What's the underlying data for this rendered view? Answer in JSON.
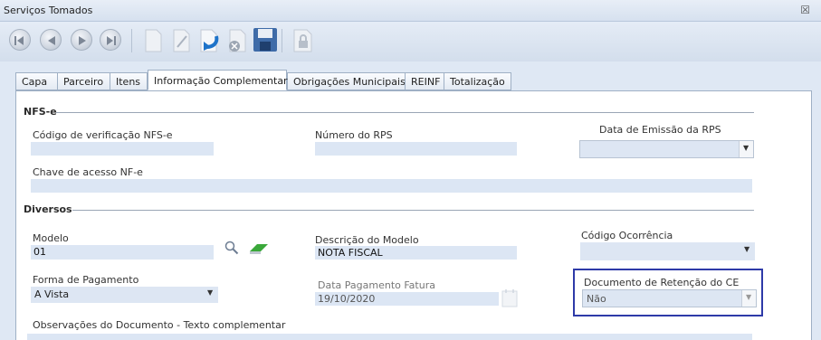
{
  "window": {
    "title": "Serviços Tomados",
    "close_glyph": "☒"
  },
  "tabs": [
    {
      "label": "Capa"
    },
    {
      "label": "Parceiro"
    },
    {
      "label": "Itens"
    },
    {
      "label": "Informação Complementar"
    },
    {
      "label": "Obrigações Municipais"
    },
    {
      "label": "REINF"
    },
    {
      "label": "Totalização"
    }
  ],
  "active_tab": 3,
  "nfse": {
    "section_title": "NFS-e",
    "codigo_label": "Código de verificação NFS-e",
    "codigo_value": "",
    "numero_rps_label": "Número do RPS",
    "numero_rps_value": "",
    "data_emissao_label": "Data de Emissão da RPS",
    "data_emissao_value": "",
    "chave_label": "Chave de acesso NF-e",
    "chave_value": ""
  },
  "diversos": {
    "section_title": "Diversos",
    "modelo_label": "Modelo",
    "modelo_value": "01",
    "descricao_label": "Descrição do Modelo",
    "descricao_value": "NOTA FISCAL",
    "ocorrencia_label": "Código Ocorrência",
    "ocorrencia_value": "",
    "forma_label": "Forma de Pagamento",
    "forma_value": "A Vista",
    "data_pag_label": "Data Pagamento Fatura",
    "data_pag_value": "19/10/2020",
    "doc_ret_label": "Documento de Retenção do CE",
    "doc_ret_value": "Não",
    "obs_label": "Observações do Documento - Texto complementar"
  },
  "colors": {
    "accent_highlight": "#2e3aa8",
    "field_bg": "#dce6f4"
  }
}
